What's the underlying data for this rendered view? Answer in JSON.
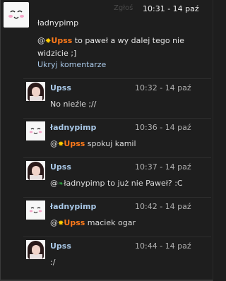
{
  "post": {
    "report_label": "Zgłoś",
    "time": "10:31 - 14 paź",
    "author": "ładnypimp",
    "mention_prefix": "@",
    "mention": "Upss",
    "text": "to paweł a wy dalej tego nie widzicie ;]",
    "hide_comments": "Ukryj komentarze"
  },
  "replies": [
    {
      "author": "Upss",
      "time": "10:32 - 14 paź",
      "text": "No nieźle ;//",
      "avatar": "girl"
    },
    {
      "author": "ładnypimp",
      "time": "10:36 - 14 paź",
      "mention_prefix": "@",
      "mention": "Upss",
      "text": "spokuj kamil",
      "avatar": "kawaii"
    },
    {
      "author": "Upss",
      "time": "10:37 - 14 paź",
      "mention_prefix": "@",
      "text": "ładnypimp to już nie Paweł? :C",
      "avatar": "girl"
    },
    {
      "author": "ładnypimp",
      "time": "10:42 - 14 paź",
      "mention_prefix": "@",
      "mention": "Upss",
      "text": "maciek ogar",
      "avatar": "kawaii"
    },
    {
      "author": "Upss",
      "time": "10:44 - 14 paź",
      "text": ":/",
      "avatar": "girl"
    }
  ]
}
